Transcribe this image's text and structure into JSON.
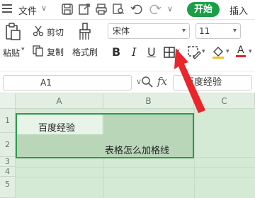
{
  "menubar": {
    "menu_icon": "hamburger-icon",
    "file_label": "文件",
    "chevron": "∨",
    "quick_icons": [
      "save-icon",
      "export-icon",
      "print-icon",
      "preview-icon",
      "undo-icon",
      "redo-icon",
      "more-chevron-icon"
    ],
    "start_tab": "开始",
    "insert_tab": "插入",
    "start_color": "#1a9e48"
  },
  "ribbon": {
    "paste_label": "粘贴",
    "cut_label": "剪切",
    "copy_label": "复制",
    "format_painter_label": "格式刷",
    "font_name": "宋体",
    "font_size": "11",
    "bold": "B",
    "italic": "I",
    "underline": "U"
  },
  "formula_bar": {
    "cell_ref": "A1",
    "fx_label": "fx",
    "content": "百度经验"
  },
  "sheet": {
    "columns": [
      "A",
      "B",
      "C"
    ],
    "rows": [
      "1",
      "2",
      "3",
      "4",
      "5"
    ],
    "cells": {
      "A1": "百度经验",
      "B2": "表格怎么加格线"
    },
    "selection_color": "#2f9a4c"
  },
  "annotation": {
    "arrow_color": "#e8262b"
  }
}
